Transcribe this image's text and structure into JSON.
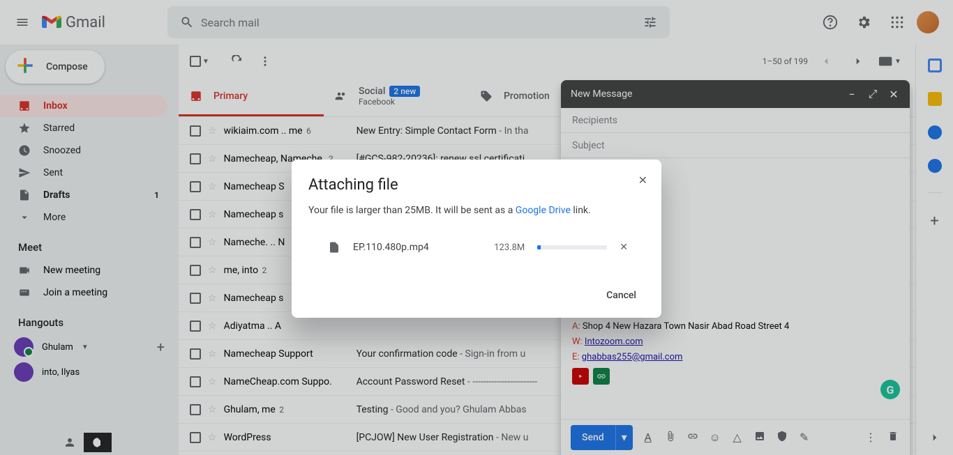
{
  "header": {
    "app_name": "Gmail",
    "search_placeholder": "Search mail"
  },
  "sidebar": {
    "compose": "Compose",
    "items": [
      {
        "label": "Inbox",
        "count": ""
      },
      {
        "label": "Starred",
        "count": ""
      },
      {
        "label": "Snoozed",
        "count": ""
      },
      {
        "label": "Sent",
        "count": ""
      },
      {
        "label": "Drafts",
        "count": "1"
      },
      {
        "label": "More",
        "count": ""
      }
    ],
    "meet_header": "Meet",
    "meet": [
      {
        "label": "New meeting"
      },
      {
        "label": "Join a meeting"
      }
    ],
    "hangouts_header": "Hangouts",
    "hangouts_name": "Ghulam",
    "contacts": [
      {
        "label": "into, Ilyas"
      }
    ]
  },
  "toolbar": {
    "range": "1–50 of 199"
  },
  "tabs": {
    "primary": "Primary",
    "social": "Social",
    "social_badge": "2 new",
    "social_sub": "Facebook",
    "promotions": "Promotion"
  },
  "emails": [
    {
      "sender": "wikiaim.com .. me",
      "count": "6",
      "subject": "New Entry: Simple Contact Form",
      "snippet": " - In tha"
    },
    {
      "sender": "Namecheap, Nameche.",
      "count": "2",
      "subject": "[#GCS-982-20236]: renew ssl certificati",
      "snippet": ""
    },
    {
      "sender": "Namecheap S",
      "count": "",
      "subject": "",
      "snippet": ""
    },
    {
      "sender": "Namecheap s",
      "count": "",
      "subject": "",
      "snippet": ""
    },
    {
      "sender": "Nameche. .. N",
      "count": "",
      "subject": "",
      "snippet": ""
    },
    {
      "sender": "me, into",
      "count": "2",
      "subject": "",
      "snippet": ""
    },
    {
      "sender": "Namecheap s",
      "count": "",
      "subject": "",
      "snippet": ""
    },
    {
      "sender": "Adiyatma .. A",
      "count": "",
      "subject": "",
      "snippet": ""
    },
    {
      "sender": "Namecheap Support",
      "count": "",
      "subject": "Your confirmation code",
      "snippet": " - Sign-in from u"
    },
    {
      "sender": "NameCheap.com Suppo.",
      "count": "",
      "subject": "Account Password Reset",
      "snippet": " - ------------------------"
    },
    {
      "sender": "Ghulam, me",
      "count": "2",
      "subject": "Testing",
      "snippet": " - Good and you? Ghulam Abbas"
    },
    {
      "sender": "WordPress",
      "count": "",
      "subject": "[PCJOW] New User Registration",
      "snippet": " - New u"
    }
  ],
  "compose_win": {
    "title": "New Message",
    "recipients": "Recipients",
    "subject": "Subject",
    "sig_a": "Shop 4 New Hazara Town Nasir Abad Road Street 4",
    "sig_w": "Intozoom.com",
    "sig_e": "ghabbas255@gmail.com",
    "send": "Send"
  },
  "dialog": {
    "title": "Attaching file",
    "body_pre": "Your file is larger than 25MB. It will be sent as a ",
    "body_link": "Google Drive",
    "body_post": " link.",
    "file_name": "EP.110.480p.mp4",
    "file_size": "123.8M",
    "cancel": "Cancel"
  }
}
